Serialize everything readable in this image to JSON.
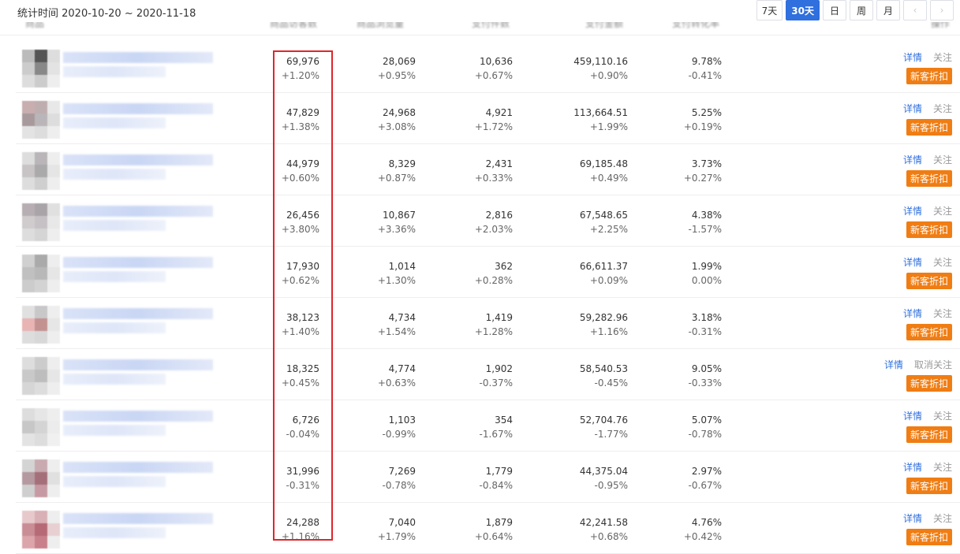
{
  "stat_time": "统计时间 2020-10-20 ~ 2020-11-18",
  "range_buttons": [
    {
      "label": "7天",
      "active": false
    },
    {
      "label": "30天",
      "active": true
    },
    {
      "label": "日",
      "active": false
    },
    {
      "label": "周",
      "active": false
    },
    {
      "label": "月",
      "active": false
    },
    {
      "label": "‹",
      "active": false
    },
    {
      "label": "›",
      "active": false
    }
  ],
  "header": [
    "商品",
    "商品访客数",
    "商品浏览量",
    "支付件数",
    "支付金额",
    "支付转化率",
    "操作"
  ],
  "ops": {
    "detail": "详情",
    "follow": "关注",
    "unfollow": "取消关注",
    "promo": "新客折扣"
  },
  "colors": {
    "accent": "#2f6fde",
    "promo": "#f07d13",
    "highlight": "#e0262a"
  },
  "rows": [
    {
      "visitors": "69,976",
      "visitors_chg": "+1.20%",
      "views": "28,069",
      "views_chg": "+0.95%",
      "qty": "10,636",
      "qty_chg": "+0.67%",
      "amount": "459,110.16",
      "amount_chg": "+0.90%",
      "rate": "9.78%",
      "rate_chg": "-0.41%",
      "follow": "关注"
    },
    {
      "visitors": "47,829",
      "visitors_chg": "+1.38%",
      "views": "24,968",
      "views_chg": "+3.08%",
      "qty": "4,921",
      "qty_chg": "+1.72%",
      "amount": "113,664.51",
      "amount_chg": "+1.99%",
      "rate": "5.25%",
      "rate_chg": "+0.19%",
      "follow": "关注"
    },
    {
      "visitors": "44,979",
      "visitors_chg": "+0.60%",
      "views": "8,329",
      "views_chg": "+0.87%",
      "qty": "2,431",
      "qty_chg": "+0.33%",
      "amount": "69,185.48",
      "amount_chg": "+0.49%",
      "rate": "3.73%",
      "rate_chg": "+0.27%",
      "follow": "关注"
    },
    {
      "visitors": "26,456",
      "visitors_chg": "+3.80%",
      "views": "10,867",
      "views_chg": "+3.36%",
      "qty": "2,816",
      "qty_chg": "+2.03%",
      "amount": "67,548.65",
      "amount_chg": "+2.25%",
      "rate": "4.38%",
      "rate_chg": "-1.57%",
      "follow": "关注"
    },
    {
      "visitors": "17,930",
      "visitors_chg": "+0.62%",
      "views": "1,014",
      "views_chg": "+1.30%",
      "qty": "362",
      "qty_chg": "+0.28%",
      "amount": "66,611.37",
      "amount_chg": "+0.09%",
      "rate": "1.99%",
      "rate_chg": "0.00%",
      "follow": "关注"
    },
    {
      "visitors": "38,123",
      "visitors_chg": "+1.40%",
      "views": "4,734",
      "views_chg": "+1.54%",
      "qty": "1,419",
      "qty_chg": "+1.28%",
      "amount": "59,282.96",
      "amount_chg": "+1.16%",
      "rate": "3.18%",
      "rate_chg": "-0.31%",
      "follow": "关注"
    },
    {
      "visitors": "18,325",
      "visitors_chg": "+0.45%",
      "views": "4,774",
      "views_chg": "+0.63%",
      "qty": "1,902",
      "qty_chg": "-0.37%",
      "amount": "58,540.53",
      "amount_chg": "-0.45%",
      "rate": "9.05%",
      "rate_chg": "-0.33%",
      "follow": "取消关注"
    },
    {
      "visitors": "6,726",
      "visitors_chg": "-0.04%",
      "views": "1,103",
      "views_chg": "-0.99%",
      "qty": "354",
      "qty_chg": "-1.67%",
      "amount": "52,704.76",
      "amount_chg": "-1.77%",
      "rate": "5.07%",
      "rate_chg": "-0.78%",
      "follow": "关注"
    },
    {
      "visitors": "31,996",
      "visitors_chg": "-0.31%",
      "views": "7,269",
      "views_chg": "-0.78%",
      "qty": "1,779",
      "qty_chg": "-0.84%",
      "amount": "44,375.04",
      "amount_chg": "-0.95%",
      "rate": "2.97%",
      "rate_chg": "-0.67%",
      "follow": "关注"
    },
    {
      "visitors": "24,288",
      "visitors_chg": "+1.16%",
      "views": "7,040",
      "views_chg": "+1.79%",
      "qty": "1,879",
      "qty_chg": "+0.64%",
      "amount": "42,241.58",
      "amount_chg": "+0.68%",
      "rate": "4.76%",
      "rate_chg": "+0.42%",
      "follow": "关注"
    }
  ]
}
